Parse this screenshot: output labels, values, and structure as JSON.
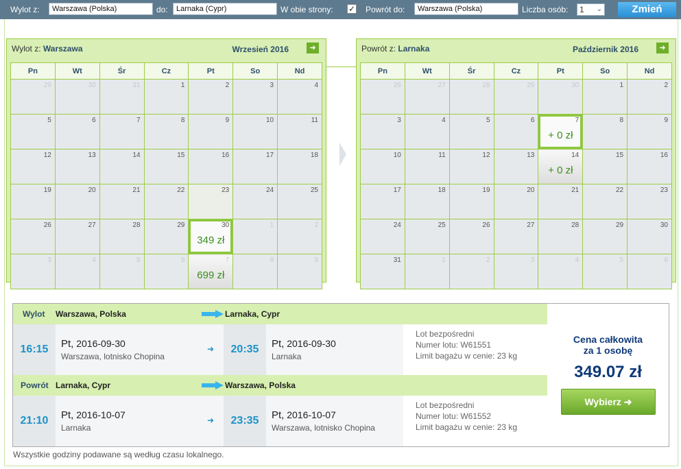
{
  "search": {
    "from_label": "Wylot z:",
    "from_value": "Warszawa (Polska)",
    "to_label": "do:",
    "to_value": "Larnaka (Cypr)",
    "roundtrip_label": "W obie strony:",
    "roundtrip_checked": "✓",
    "return_label": "Powrót do:",
    "return_value": "Warszawa (Polska)",
    "persons_label": "Liczba osób:",
    "persons_value": "1",
    "change_button": "Zmień"
  },
  "weekdays": [
    "Pn",
    "Wt",
    "Śr",
    "Cz",
    "Pt",
    "So",
    "Nd"
  ],
  "calendars": [
    {
      "title_prefix": "Wylot z:",
      "city": "Warszawa",
      "month": "Wrzesień 2016",
      "weeks": [
        [
          {
            "d": "29",
            "o": 1
          },
          {
            "d": "30",
            "o": 1
          },
          {
            "d": "31",
            "o": 1
          },
          {
            "d": "1"
          },
          {
            "d": "2"
          },
          {
            "d": "3"
          },
          {
            "d": "4"
          }
        ],
        [
          {
            "d": "5"
          },
          {
            "d": "6"
          },
          {
            "d": "7"
          },
          {
            "d": "8"
          },
          {
            "d": "9"
          },
          {
            "d": "10"
          },
          {
            "d": "11"
          }
        ],
        [
          {
            "d": "12"
          },
          {
            "d": "13"
          },
          {
            "d": "14"
          },
          {
            "d": "15"
          },
          {
            "d": "16"
          },
          {
            "d": "17"
          },
          {
            "d": "18"
          }
        ],
        [
          {
            "d": "19"
          },
          {
            "d": "20"
          },
          {
            "d": "21"
          },
          {
            "d": "22"
          },
          {
            "d": "23",
            "h": 1
          },
          {
            "d": "24"
          },
          {
            "d": "25"
          }
        ],
        [
          {
            "d": "26"
          },
          {
            "d": "27"
          },
          {
            "d": "28"
          },
          {
            "d": "29"
          },
          {
            "d": "30",
            "p": "349 zł",
            "s": 1
          },
          {
            "d": "1",
            "o": 1
          },
          {
            "d": "2",
            "o": 1
          }
        ],
        [
          {
            "d": "3",
            "o": 1
          },
          {
            "d": "4",
            "o": 1
          },
          {
            "d": "5",
            "o": 1
          },
          {
            "d": "6",
            "o": 1
          },
          {
            "d": "7",
            "o": 1,
            "p": "699 zł"
          },
          {
            "d": "8",
            "o": 1
          },
          {
            "d": "9",
            "o": 1
          }
        ]
      ]
    },
    {
      "title_prefix": "Powrót z:",
      "city": "Larnaka",
      "month": "Październik 2016",
      "weeks": [
        [
          {
            "d": "26",
            "o": 1
          },
          {
            "d": "27",
            "o": 1
          },
          {
            "d": "28",
            "o": 1
          },
          {
            "d": "29",
            "o": 1
          },
          {
            "d": "30",
            "o": 1
          },
          {
            "d": "1"
          },
          {
            "d": "2"
          }
        ],
        [
          {
            "d": "3"
          },
          {
            "d": "4"
          },
          {
            "d": "5"
          },
          {
            "d": "6"
          },
          {
            "d": "7",
            "p": "+ 0 zł",
            "s": 1
          },
          {
            "d": "8"
          },
          {
            "d": "9"
          }
        ],
        [
          {
            "d": "10"
          },
          {
            "d": "11"
          },
          {
            "d": "12"
          },
          {
            "d": "13"
          },
          {
            "d": "14",
            "p": "+ 0 zł"
          },
          {
            "d": "15"
          },
          {
            "d": "16"
          }
        ],
        [
          {
            "d": "17"
          },
          {
            "d": "18"
          },
          {
            "d": "19"
          },
          {
            "d": "20"
          },
          {
            "d": "21"
          },
          {
            "d": "22"
          },
          {
            "d": "23"
          }
        ],
        [
          {
            "d": "24"
          },
          {
            "d": "25"
          },
          {
            "d": "26"
          },
          {
            "d": "27"
          },
          {
            "d": "28"
          },
          {
            "d": "29"
          },
          {
            "d": "30"
          }
        ],
        [
          {
            "d": "31"
          },
          {
            "d": "1",
            "o": 1
          },
          {
            "d": "2",
            "o": 1
          },
          {
            "d": "3",
            "o": 1
          },
          {
            "d": "4",
            "o": 1
          },
          {
            "d": "5",
            "o": 1
          },
          {
            "d": "6",
            "o": 1
          }
        ]
      ]
    }
  ],
  "segments": [
    {
      "label": "Wylot",
      "from_city": "Warszawa, Polska",
      "to_city": "Larnaka, Cypr",
      "dep_time": "16:15",
      "dep_day": "Pt,",
      "dep_date": "2016-09-30",
      "dep_place": "Warszawa, lotnisko Chopina",
      "arr_time": "20:35",
      "arr_day": "Pt,",
      "arr_date": "2016-09-30",
      "arr_place": "Larnaka",
      "flight_type": "Lot bezpośredni",
      "flight_no": "Numer lotu: W61551",
      "baggage": "Limit bagażu w cenie: 23 kg"
    },
    {
      "label": "Powrót",
      "from_city": "Larnaka, Cypr",
      "to_city": "Warszawa, Polska",
      "dep_time": "21:10",
      "dep_day": "Pt,",
      "dep_date": "2016-10-07",
      "dep_place": "Larnaka",
      "arr_time": "23:35",
      "arr_day": "Pt,",
      "arr_date": "2016-10-07",
      "arr_place": "Warszawa, lotnisko Chopina",
      "flight_type": "Lot bezpośredni",
      "flight_no": "Numer lotu: W61552",
      "baggage": "Limit bagażu w cenie: 23 kg"
    }
  ],
  "price": {
    "title_line1": "Cena całkowita",
    "title_line2": "za 1 osobę",
    "amount": "349.07 zł",
    "button": "Wybierz"
  },
  "footnote": "Wszystkie godziny podawane są według czasu lokalnego.",
  "colors": {
    "accent_green": "#9ccc45",
    "top_bar": "#5e7a8e",
    "time_blue": "#1d92c8",
    "price_navy": "#0f3a7a"
  }
}
